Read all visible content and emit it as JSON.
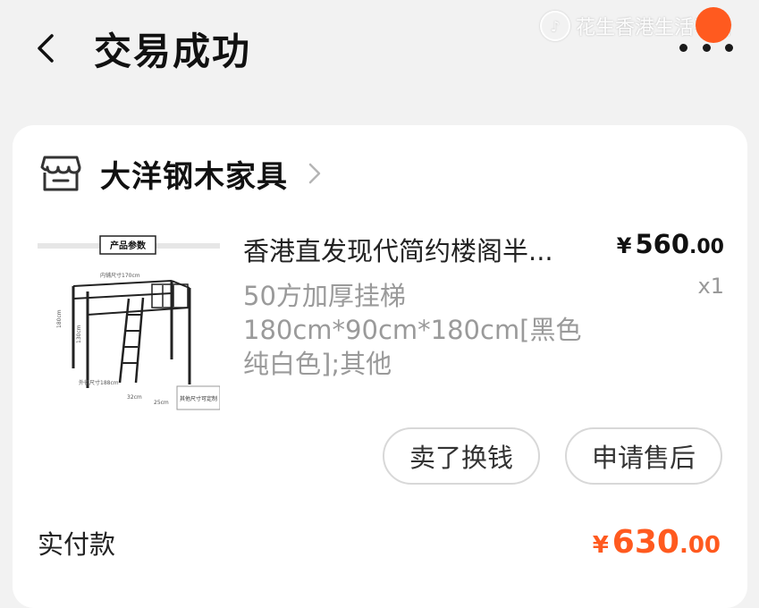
{
  "header": {
    "title": "交易成功",
    "back_icon": "chevron-left-icon",
    "more_icon": "more-dots-icon"
  },
  "watermark": {
    "text": "花生香港生活平台"
  },
  "shop": {
    "icon": "shop-icon",
    "name": "大洋钢木家具",
    "arrow_icon": "chevron-right-icon"
  },
  "product": {
    "title": "香港直发现代简约楼阁半...",
    "price_currency": "¥",
    "price_integer": "560",
    "price_decimal": ".00",
    "quantity": "x1",
    "spec": "50方加厚挂梯 180cm*90cm*180cm[黑色纯白色];其他",
    "image": {
      "banner": "产品参数",
      "labels": [
        "内铺尺寸170cm",
        "180cm",
        "130cm",
        "外径尺寸188cm",
        "32cm",
        "25cm",
        "其他尺寸可定制"
      ]
    }
  },
  "actions": {
    "sell_label": "卖了换钱",
    "after_sale_label": "申请售后"
  },
  "payment": {
    "label": "实付款",
    "currency": "¥",
    "integer": "630",
    "decimal": ".00"
  },
  "colors": {
    "accent": "#ff5a1f",
    "background": "#f2f2f2",
    "card": "#ffffff",
    "muted_text": "#9a9a9a"
  }
}
